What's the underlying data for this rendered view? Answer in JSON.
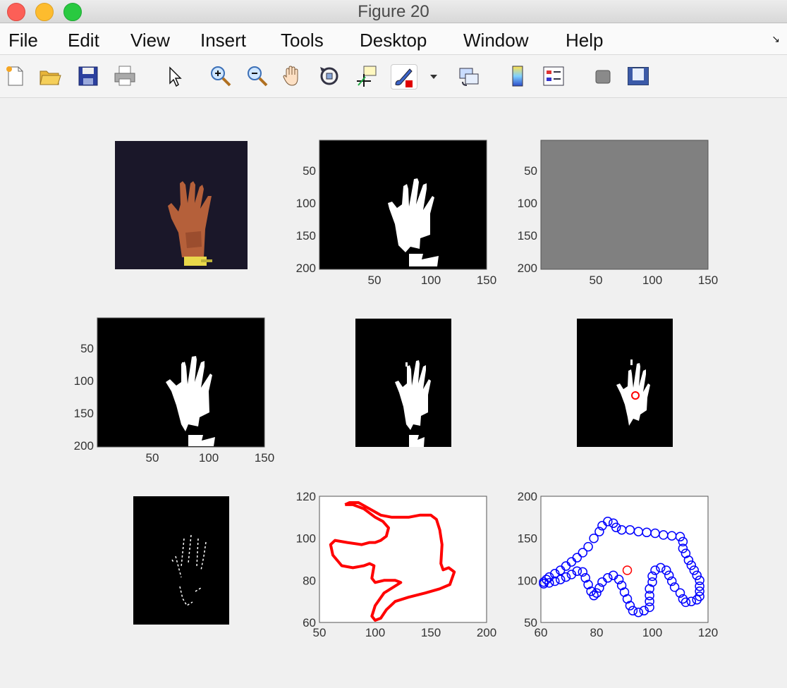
{
  "window": {
    "title": "Figure 20"
  },
  "menu": {
    "items": [
      "File",
      "Edit",
      "View",
      "Insert",
      "Tools",
      "Desktop",
      "Window",
      "Help"
    ],
    "corner_glyph": "↘"
  },
  "toolbar": {
    "icons": [
      "new-figure-icon",
      "open-file-icon",
      "save-icon",
      "print-icon",
      "pointer-icon",
      "zoom-in-icon",
      "zoom-out-icon",
      "pan-hand-icon",
      "rotate-3d-icon",
      "data-cursor-icon",
      "brush-icon",
      "brush-dropdown-icon",
      "link-plot-icon",
      "colorbar-icon",
      "legend-icon",
      "hide-plot-tools-icon",
      "show-plot-tools-icon"
    ]
  },
  "colors": {
    "image_bg": "#000000",
    "gray_fill": "#808080",
    "contour": "#ff0000",
    "markers": "#0000ff",
    "centroid": "#ff0000"
  },
  "axes": {
    "ax2": {
      "xticks": [
        "50",
        "100",
        "150"
      ],
      "yticks": [
        "50",
        "100",
        "150",
        "200"
      ]
    },
    "ax3": {
      "xticks": [
        "50",
        "100",
        "150"
      ],
      "yticks": [
        "50",
        "100",
        "150",
        "200"
      ]
    },
    "ax4": {
      "xticks": [
        "50",
        "100",
        "150"
      ],
      "yticks": [
        "50",
        "100",
        "150",
        "200"
      ]
    }
  },
  "chart_data": [
    {
      "type": "line",
      "xlim": [
        50,
        200
      ],
      "ylim": [
        60,
        120
      ],
      "xticks": [
        "50",
        "100",
        "150",
        "200"
      ],
      "yticks": [
        "60",
        "80",
        "100",
        "120"
      ],
      "series": [
        {
          "color": "#ff0000",
          "points": [
            [
              73,
              116
            ],
            [
              77,
              117
            ],
            [
              85,
              117
            ],
            [
              95,
              114
            ],
            [
              105,
              111
            ],
            [
              115,
              110
            ],
            [
              130,
              110
            ],
            [
              140,
              111
            ],
            [
              150,
              111
            ],
            [
              155,
              109
            ],
            [
              158,
              104
            ],
            [
              160,
              97
            ],
            [
              159,
              88
            ],
            [
              161,
              85
            ],
            [
              166,
              86
            ],
            [
              171,
              84
            ],
            [
              167,
              78
            ],
            [
              158,
              76
            ],
            [
              145,
              74
            ],
            [
              130,
              72
            ],
            [
              118,
              70
            ],
            [
              110,
              66
            ],
            [
              105,
              62
            ],
            [
              100,
              61
            ],
            [
              97,
              63
            ],
            [
              100,
              68
            ],
            [
              108,
              74
            ],
            [
              120,
              78
            ],
            [
              123,
              79
            ],
            [
              118,
              80
            ],
            [
              108,
              80
            ],
            [
              100,
              79
            ],
            [
              97,
              81
            ],
            [
              99,
              87
            ],
            [
              95,
              88
            ],
            [
              90,
              87
            ],
            [
              80,
              86
            ],
            [
              70,
              87
            ],
            [
              62,
              92
            ],
            [
              60,
              97
            ],
            [
              64,
              99
            ],
            [
              75,
              98
            ],
            [
              88,
              97
            ],
            [
              95,
              98
            ],
            [
              100,
              98
            ],
            [
              105,
              99
            ],
            [
              110,
              101
            ],
            [
              112,
              105
            ],
            [
              107,
              108
            ],
            [
              100,
              110
            ],
            [
              90,
              114
            ],
            [
              80,
              116
            ],
            [
              73,
              116
            ]
          ]
        }
      ]
    },
    {
      "type": "scatter",
      "xlim": [
        60,
        120
      ],
      "ylim": [
        50,
        200
      ],
      "xticks": [
        "60",
        "80",
        "100",
        "120"
      ],
      "yticks": [
        "50",
        "100",
        "150",
        "200"
      ],
      "series": [
        {
          "color": "#0000ff",
          "marker": "o",
          "points": [
            [
              61,
              98
            ],
            [
              62,
              101
            ],
            [
              63,
              104
            ],
            [
              65,
              108
            ],
            [
              67,
              112
            ],
            [
              69,
              117
            ],
            [
              71,
              122
            ],
            [
              73,
              127
            ],
            [
              75,
              133
            ],
            [
              77,
              140
            ],
            [
              79,
              150
            ],
            [
              81,
              158
            ],
            [
              82,
              165
            ],
            [
              84,
              170
            ],
            [
              86,
              168
            ],
            [
              87,
              163
            ],
            [
              89,
              160
            ],
            [
              92,
              160
            ],
            [
              95,
              158
            ],
            [
              98,
              157
            ],
            [
              101,
              156
            ],
            [
              104,
              154
            ],
            [
              107,
              153
            ],
            [
              110,
              152
            ],
            [
              111,
              146
            ],
            [
              111,
              138
            ],
            [
              112,
              132
            ],
            [
              113,
              124
            ],
            [
              114,
              118
            ],
            [
              115,
              112
            ],
            [
              116,
              106
            ],
            [
              117,
              100
            ],
            [
              117,
              93
            ],
            [
              117,
              87
            ],
            [
              117,
              81
            ],
            [
              116,
              77
            ],
            [
              114,
              75
            ],
            [
              112,
              74
            ],
            [
              111,
              78
            ],
            [
              110,
              85
            ],
            [
              108,
              92
            ],
            [
              107,
              99
            ],
            [
              106,
              106
            ],
            [
              105,
              112
            ],
            [
              103,
              115
            ],
            [
              101,
              112
            ],
            [
              100,
              105
            ],
            [
              100,
              98
            ],
            [
              99,
              90
            ],
            [
              99,
              82
            ],
            [
              99,
              75
            ],
            [
              99,
              68
            ],
            [
              97,
              64
            ],
            [
              95,
              62
            ],
            [
              93,
              64
            ],
            [
              92,
              70
            ],
            [
              91,
              78
            ],
            [
              90,
              86
            ],
            [
              89,
              94
            ],
            [
              88,
              101
            ],
            [
              86,
              106
            ],
            [
              84,
              103
            ],
            [
              82,
              98
            ],
            [
              81,
              91
            ],
            [
              80,
              85
            ],
            [
              79,
              82
            ],
            [
              78,
              87
            ],
            [
              77,
              95
            ],
            [
              76,
              103
            ],
            [
              75,
              110
            ],
            [
              73,
              111
            ],
            [
              71,
              107
            ],
            [
              69,
              104
            ],
            [
              67,
              101
            ],
            [
              65,
              99
            ],
            [
              63,
              97
            ],
            [
              61,
              96
            ]
          ]
        },
        {
          "color": "#ff0000",
          "marker": "o",
          "points": [
            [
              91,
              112
            ]
          ]
        }
      ]
    }
  ]
}
